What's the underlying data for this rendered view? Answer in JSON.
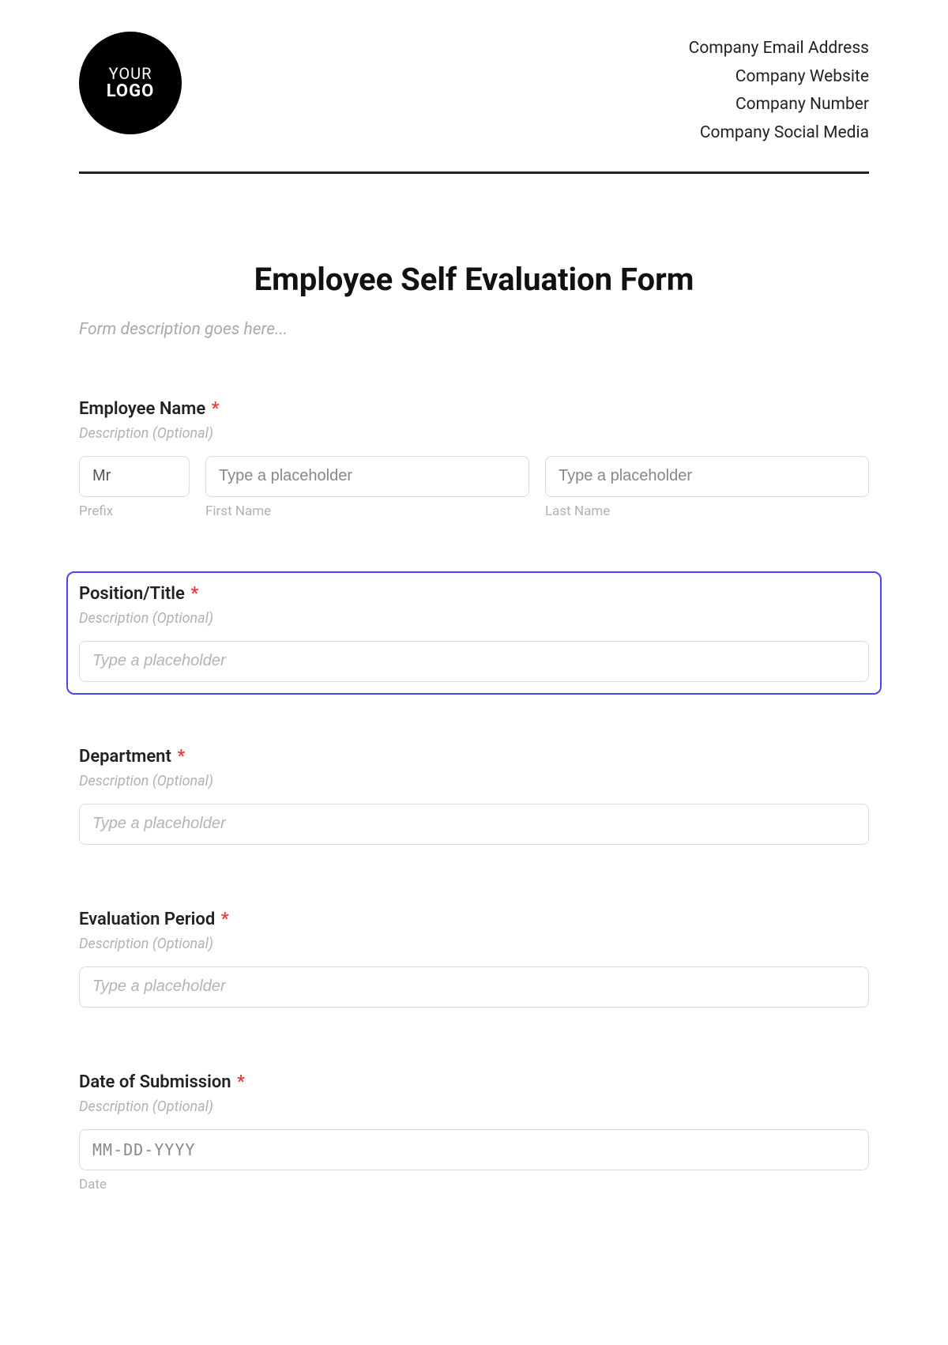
{
  "header": {
    "logo_line1": "YOUR",
    "logo_line2": "LOGO",
    "company_lines": [
      "Company Email Address",
      "Company Website",
      "Company Number",
      "Company Social Media"
    ]
  },
  "form": {
    "title": "Employee Self Evaluation Form",
    "description_placeholder": "Form description goes here...",
    "fields": {
      "employee_name": {
        "label": "Employee Name",
        "required_mark": "*",
        "description_placeholder": "Description (Optional)",
        "prefix_value": "Mr",
        "prefix_sublabel": "Prefix",
        "first_placeholder": "Type a placeholder",
        "first_sublabel": "First Name",
        "last_placeholder": "Type a placeholder",
        "last_sublabel": "Last Name"
      },
      "position": {
        "label": "Position/Title",
        "required_mark": "*",
        "description_placeholder": "Description (Optional)",
        "input_placeholder": "Type a placeholder"
      },
      "department": {
        "label": "Department",
        "required_mark": "*",
        "description_placeholder": "Description (Optional)",
        "input_placeholder": "Type a placeholder"
      },
      "evaluation_period": {
        "label": "Evaluation Period",
        "required_mark": "*",
        "description_placeholder": "Description (Optional)",
        "input_placeholder": "Type a placeholder"
      },
      "date_of_submission": {
        "label": "Date of Submission",
        "required_mark": "*",
        "description_placeholder": "Description (Optional)",
        "input_placeholder": "MM-DD-YYYY",
        "sublabel": "Date"
      }
    }
  }
}
